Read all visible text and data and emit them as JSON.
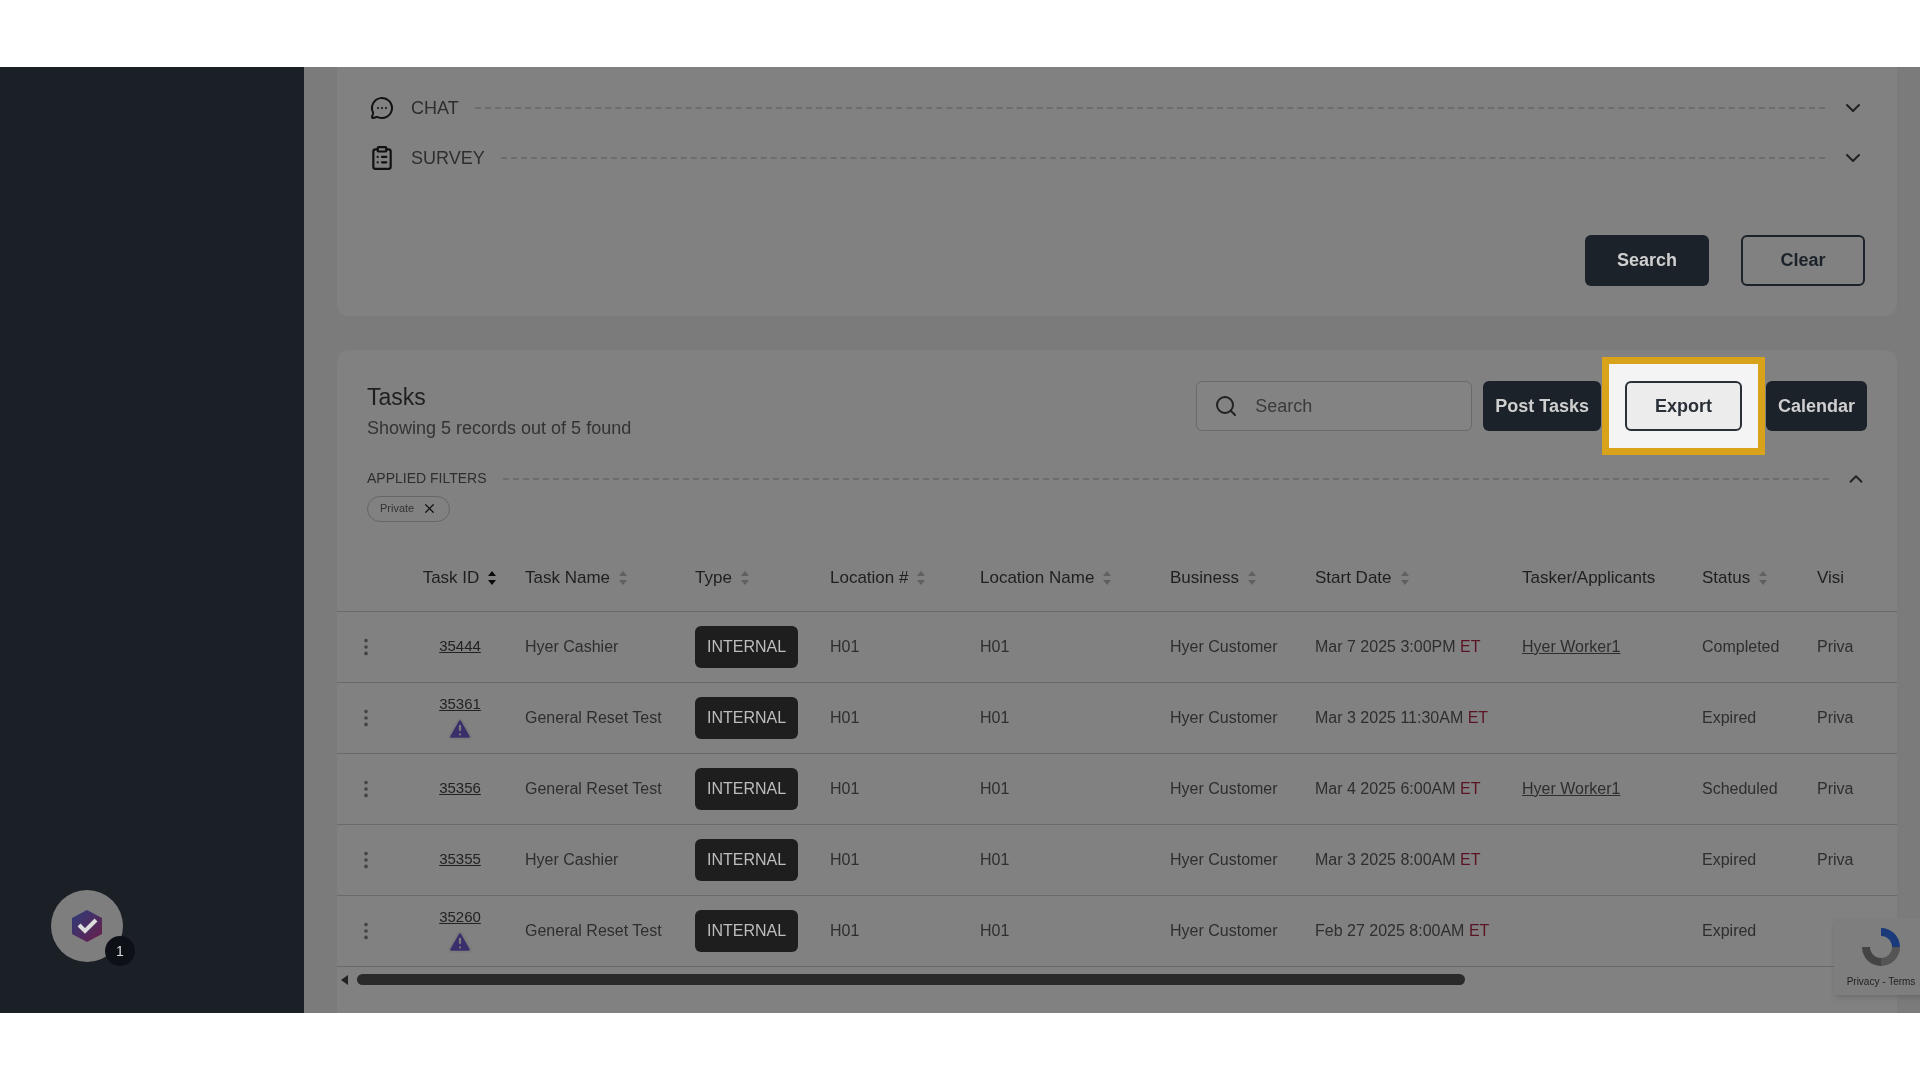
{
  "filter_sections": [
    {
      "label": "CHAT",
      "expanded": false
    },
    {
      "label": "SURVEY",
      "expanded": false
    }
  ],
  "filter_buttons": [
    {
      "label": "Search",
      "kind": "primary"
    },
    {
      "label": "Clear",
      "kind": "outline"
    }
  ],
  "tasks": {
    "title": "Tasks",
    "subtitle": "Showing 5 records out of 5 found",
    "search": {
      "placeholder": "Search"
    },
    "actions": [
      {
        "label": "Post Tasks",
        "kind": "primary",
        "highlighted": false
      },
      {
        "label": "Export",
        "kind": "outline",
        "highlighted": true
      },
      {
        "label": "Calendar",
        "kind": "primary",
        "highlighted": false
      }
    ],
    "applied_filters": {
      "label": "APPLIED FILTERS",
      "expanded": true,
      "chips": [
        "Private"
      ]
    },
    "columns": [
      {
        "label": "Task ID",
        "sortable": true,
        "active": true
      },
      {
        "label": "Task Name",
        "sortable": true,
        "active": false
      },
      {
        "label": "Type",
        "sortable": true,
        "active": false
      },
      {
        "label": "Location #",
        "sortable": true,
        "active": false
      },
      {
        "label": "Location Name",
        "sortable": true,
        "active": false
      },
      {
        "label": "Business",
        "sortable": true,
        "active": false
      },
      {
        "label": "Start Date",
        "sortable": true,
        "active": false
      },
      {
        "label": "Tasker/Applicants",
        "sortable": false
      },
      {
        "label": "Status",
        "sortable": true,
        "active": false
      },
      {
        "label": "Visi",
        "sortable": false
      }
    ],
    "rows": [
      {
        "task_id": "35444",
        "warning": false,
        "task_name": "Hyer Cashier",
        "type": "INTERNAL",
        "location_no": "H01",
        "location_name": "H01",
        "business": "Hyer Customer",
        "start_date": "Mar 7 2025 3:00PM",
        "timezone": "ET",
        "tasker": "Hyer Worker1",
        "status": "Completed",
        "visibility": "Priva"
      },
      {
        "task_id": "35361",
        "warning": true,
        "task_name": "General Reset Test",
        "type": "INTERNAL",
        "location_no": "H01",
        "location_name": "H01",
        "business": "Hyer Customer",
        "start_date": "Mar 3 2025 11:30AM",
        "timezone": "ET",
        "status": "Expired",
        "visibility": "Priva"
      },
      {
        "task_id": "35356",
        "warning": false,
        "task_name": "General Reset Test",
        "type": "INTERNAL",
        "location_no": "H01",
        "location_name": "H01",
        "business": "Hyer Customer",
        "start_date": "Mar 4 2025 6:00AM",
        "timezone": "ET",
        "tasker": "Hyer Worker1",
        "status": "Scheduled",
        "visibility": "Priva"
      },
      {
        "task_id": "35355",
        "warning": false,
        "task_name": "Hyer Cashier",
        "type": "INTERNAL",
        "location_no": "H01",
        "location_name": "H01",
        "business": "Hyer Customer",
        "start_date": "Mar 3 2025 8:00AM",
        "timezone": "ET",
        "status": "Expired",
        "visibility": "Priva"
      },
      {
        "task_id": "35260",
        "warning": true,
        "task_name": "General Reset Test",
        "type": "INTERNAL",
        "location_no": "H01",
        "location_name": "H01",
        "business": "Hyer Customer",
        "start_date": "Feb 27 2025 8:00AM",
        "timezone": "ET",
        "status": "Expired"
      }
    ]
  },
  "recaptcha": {
    "text": "Privacy - Terms"
  },
  "notification_badge": "1"
}
